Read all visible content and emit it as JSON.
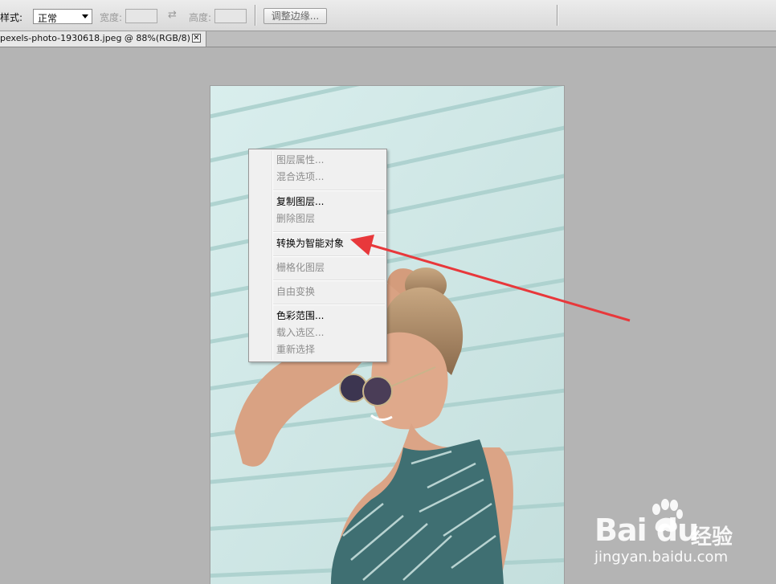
{
  "options_bar": {
    "style_label": "样式:",
    "style_value": "正常",
    "width_label": "宽度:",
    "height_label": "高度:",
    "refine_edge_label": "调整边缘..."
  },
  "document_tab": {
    "title": "pexels-photo-1930618.jpeg @ 88%(RGB/8)",
    "close_glyph": "✕"
  },
  "context_menu": {
    "items": [
      {
        "label": "图层属性...",
        "enabled": false
      },
      {
        "label": "混合选项...",
        "enabled": false
      },
      {
        "label": "复制图层...",
        "enabled": true
      },
      {
        "label": "删除图层",
        "enabled": false
      },
      {
        "label": "转换为智能对象",
        "enabled": true
      },
      {
        "label": "栅格化图层",
        "enabled": false
      },
      {
        "label": "自由变换",
        "enabled": false
      },
      {
        "label": "色彩范围...",
        "enabled": true
      },
      {
        "label": "载入选区...",
        "enabled": false
      },
      {
        "label": "重新选择",
        "enabled": false
      }
    ]
  },
  "watermark": {
    "logo": "Bai du",
    "suffix": "经验",
    "url": "jingyan.baidu.com"
  },
  "colors": {
    "annotation_arrow": "#e8383b",
    "canvas_bg": "#b4b4b4",
    "wall": "#cfe6e5"
  }
}
